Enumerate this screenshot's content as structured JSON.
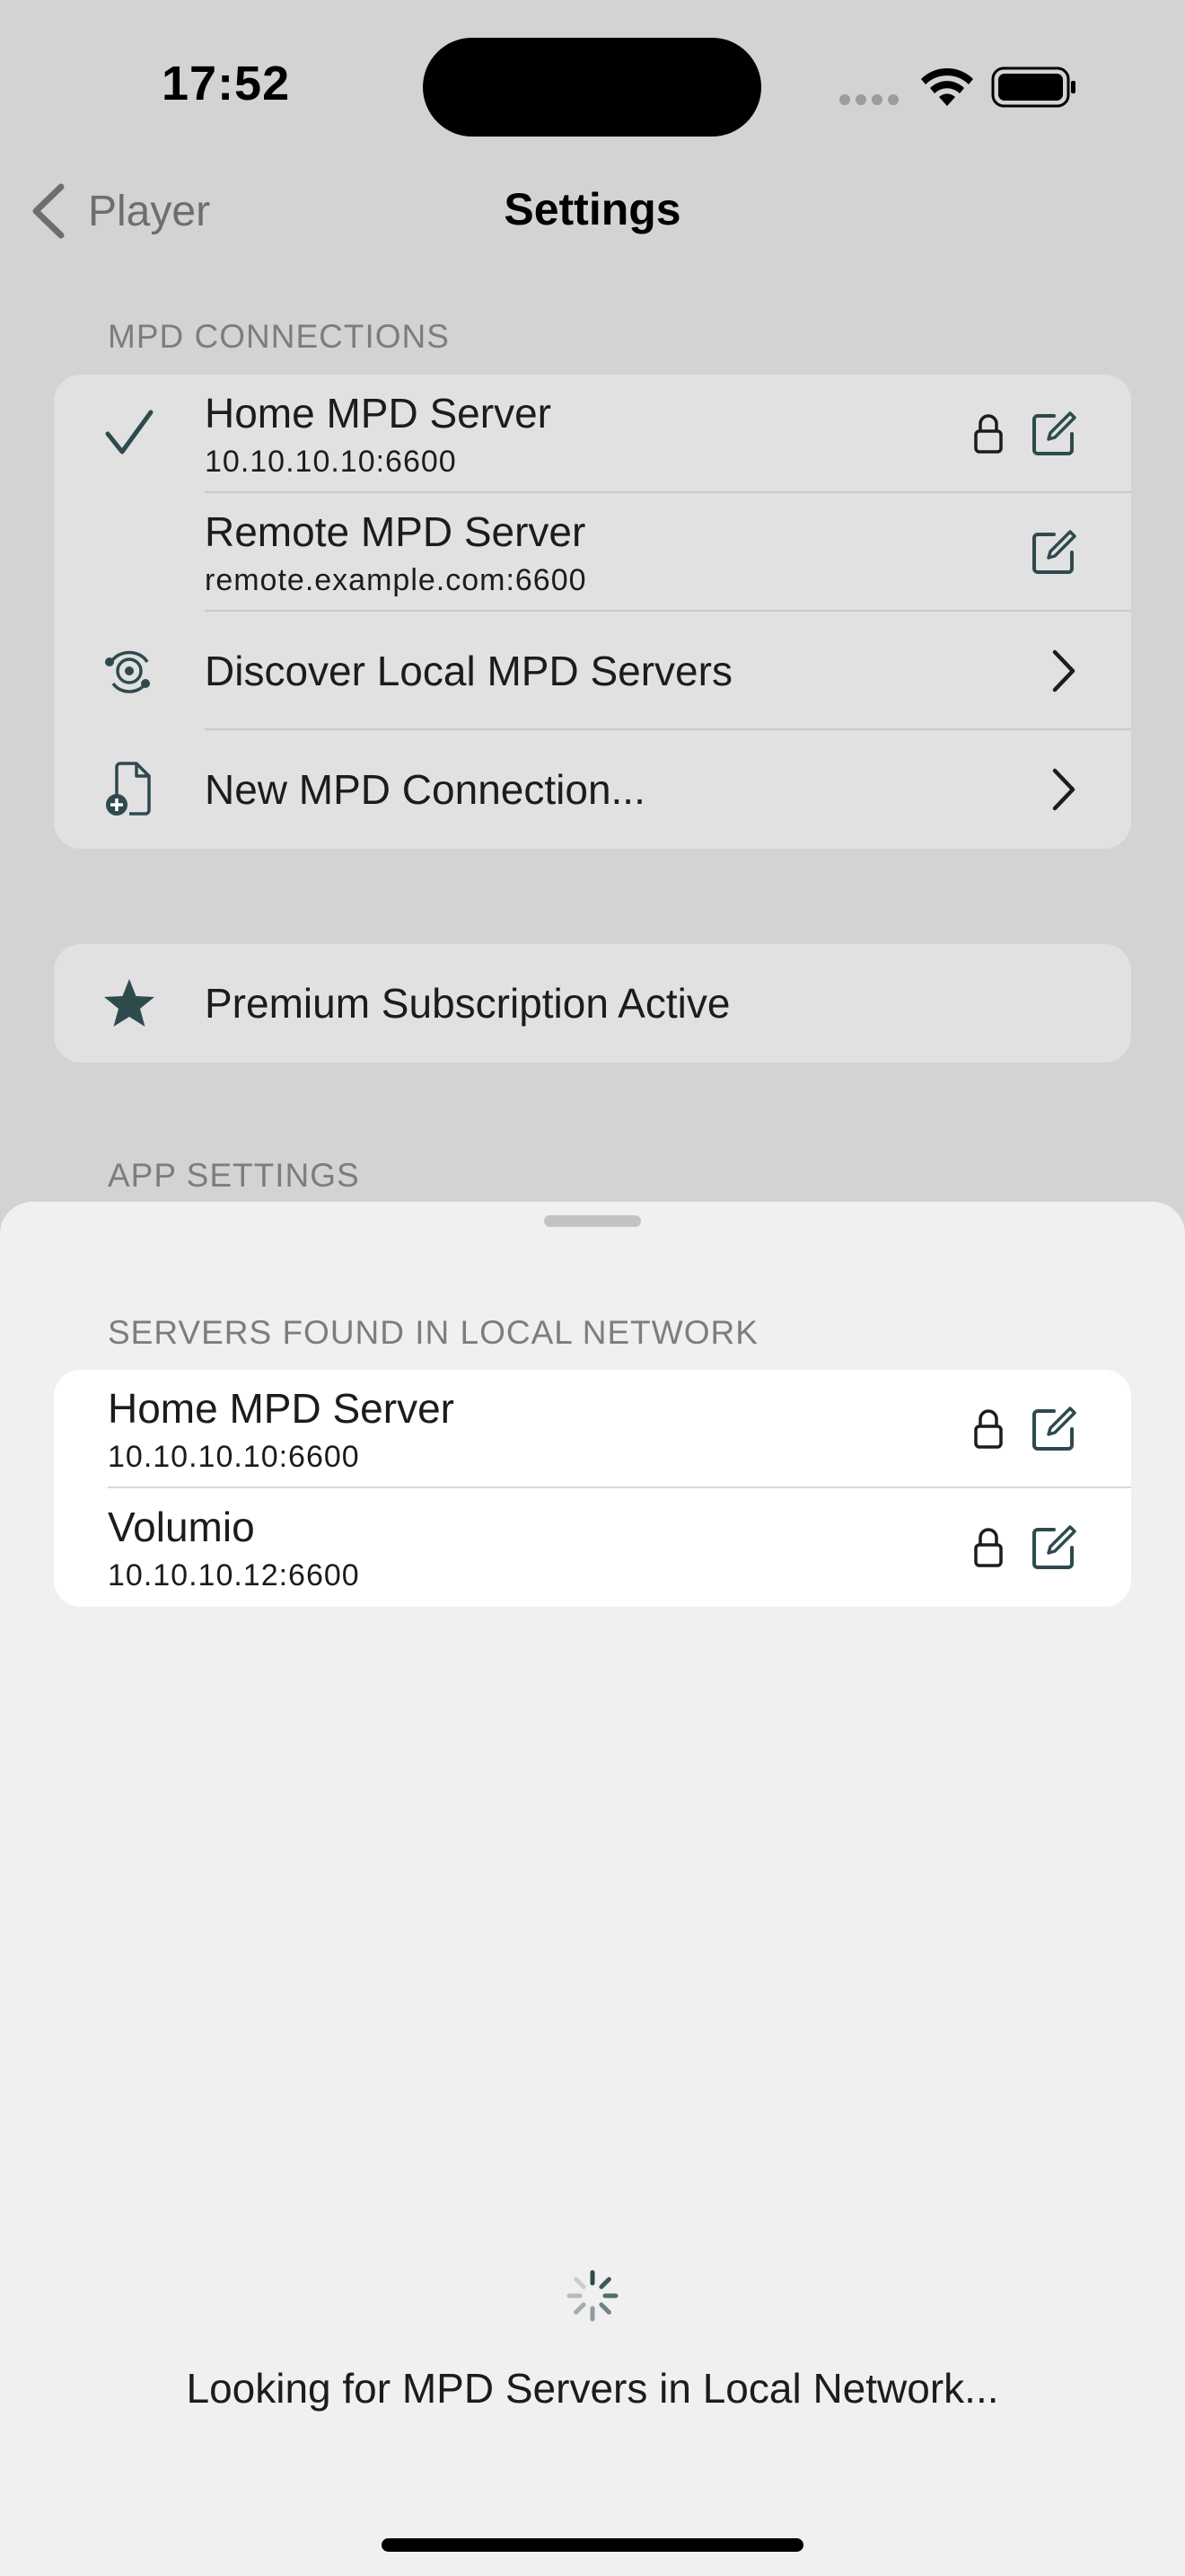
{
  "status_bar": {
    "time": "17:52"
  },
  "nav": {
    "back_label": "Player",
    "title": "Settings"
  },
  "mpd_connections": {
    "header": "MPD CONNECTIONS",
    "items": [
      {
        "name": "Home MPD Server",
        "address": "10.10.10.10:6600",
        "selected": true,
        "locked": true
      },
      {
        "name": "Remote MPD Server",
        "address": "remote.example.com:6600",
        "selected": false,
        "locked": false
      }
    ],
    "discover_label": "Discover Local MPD Servers",
    "new_connection_label": "New MPD Connection..."
  },
  "premium": {
    "label": "Premium Subscription Active"
  },
  "app_settings": {
    "header": "APP SETTINGS"
  },
  "discovery_sheet": {
    "header": "SERVERS FOUND IN LOCAL NETWORK",
    "servers": [
      {
        "name": "Home MPD Server",
        "address": "10.10.10.10:6600",
        "locked": true
      },
      {
        "name": "Volumio",
        "address": "10.10.10.12:6600",
        "locked": true
      }
    ],
    "status_message": "Looking for MPD Servers in Local Network..."
  },
  "colors": {
    "accent": "#2e4a4d",
    "sheet_bg": "#f0f0f0",
    "dimmed_bg": "#d3d3d3"
  },
  "icons": [
    "back-chevron-icon",
    "checkmark-icon",
    "lock-icon",
    "edit-icon",
    "network-discover-icon",
    "new-document-icon",
    "chevron-right-icon",
    "star-icon",
    "spinner-icon",
    "wifi-icon",
    "battery-icon"
  ]
}
